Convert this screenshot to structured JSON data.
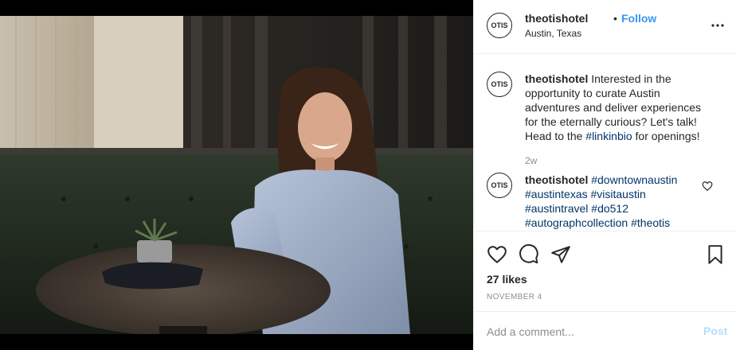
{
  "header": {
    "username": "theotishotel",
    "separator": "•",
    "follow_label": "Follow",
    "location": "Austin, Texas",
    "avatar_text": "OTIS",
    "more_icon": "more-horizontal-icon"
  },
  "caption": {
    "username": "theotishotel",
    "text": "Interested in the opportunity to curate Austin adventures and deliver experiences for the eternally curious? Let's talk! Head to the ",
    "hashtag": "#linkinbio",
    "text_end": " for openings!",
    "time": "2w"
  },
  "comment": {
    "username": "theotishotel",
    "hashtags": [
      "#downtownaustin",
      "#austintexas",
      "#visitaustin",
      "#austintravel",
      "#do512",
      "#autographcollection",
      "#theotis"
    ],
    "like_icon": "heart-outline-icon"
  },
  "actions": {
    "like_icon": "heart-icon",
    "comment_icon": "comment-icon",
    "share_icon": "paper-plane-icon",
    "save_icon": "bookmark-icon"
  },
  "likes": "27 likes",
  "date": "November 4",
  "add_comment": {
    "placeholder": "Add a comment...",
    "post_label": "Post"
  },
  "colors": {
    "link_blue": "#3897f0",
    "hashtag_blue": "#003569",
    "post_disabled": "#b2dffc",
    "muted_gray": "#8e8e8e"
  }
}
